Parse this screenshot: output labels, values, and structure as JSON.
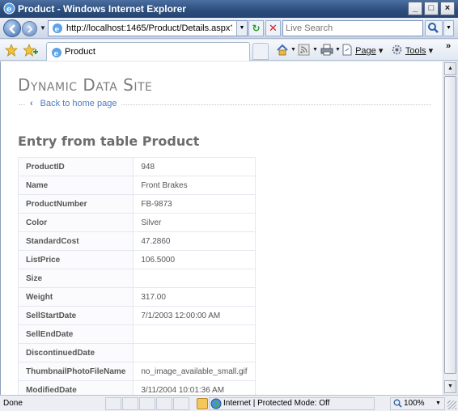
{
  "window": {
    "title": "Product - Windows Internet Explorer",
    "minimize": "_",
    "maximize": "□",
    "close": "×"
  },
  "address": {
    "url": "http://localhost:1465/Product/Details.aspx?I",
    "search_placeholder": "Live Search"
  },
  "tab": {
    "label": "Product"
  },
  "commands": {
    "page": "Page",
    "tools": "Tools",
    "more": "»"
  },
  "page": {
    "site_title": "Dynamic Data Site",
    "back_link": "Back to home page",
    "heading": "Entry from table Product",
    "rows": [
      {
        "field": "ProductID",
        "value": "948"
      },
      {
        "field": "Name",
        "value": "Front Brakes"
      },
      {
        "field": "ProductNumber",
        "value": "FB-9873"
      },
      {
        "field": "Color",
        "value": "Silver"
      },
      {
        "field": "StandardCost",
        "value": "47.2860"
      },
      {
        "field": "ListPrice",
        "value": "106.5000"
      },
      {
        "field": "Size",
        "value": ""
      },
      {
        "field": "Weight",
        "value": "317.00"
      },
      {
        "field": "SellStartDate",
        "value": "7/1/2003 12:00:00 AM"
      },
      {
        "field": "SellEndDate",
        "value": ""
      },
      {
        "field": "DiscontinuedDate",
        "value": ""
      },
      {
        "field": "ThumbnailPhotoFileName",
        "value": "no_image_available_small.gif"
      },
      {
        "field": "ModifiedDate",
        "value": "3/11/2004 10:01:36 AM"
      }
    ]
  },
  "status": {
    "text": "Done",
    "zone": "Internet | Protected Mode: Off",
    "zoom": "100%"
  },
  "colors": {
    "title_bar": "#2c4d7c",
    "link": "#4e7cc1",
    "heading": "#6d6d6d",
    "site_title": "#7d7d7d"
  }
}
